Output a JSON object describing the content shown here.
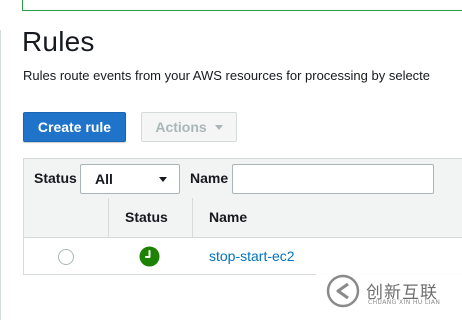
{
  "page": {
    "title": "Rules",
    "description": "Rules route events from your AWS resources for processing by selecte"
  },
  "toolbar": {
    "create_label": "Create rule",
    "actions_label": "Actions"
  },
  "filter": {
    "status_label": "Status",
    "status_value": "All",
    "name_label": "Name",
    "name_value": ""
  },
  "table": {
    "columns": [
      "",
      "Status",
      "Name"
    ],
    "rows": [
      {
        "selected": false,
        "status_icon": "clock-icon",
        "status_color": "#1d8102",
        "name": "stop-start-ec2"
      }
    ]
  },
  "watermark": {
    "cn_text": "创新互联",
    "en_text": "CHUANG XIN HU LIAN"
  },
  "colors": {
    "primary": "#1f74c9",
    "link": "#0073bb",
    "status_enabled": "#1d8102"
  }
}
